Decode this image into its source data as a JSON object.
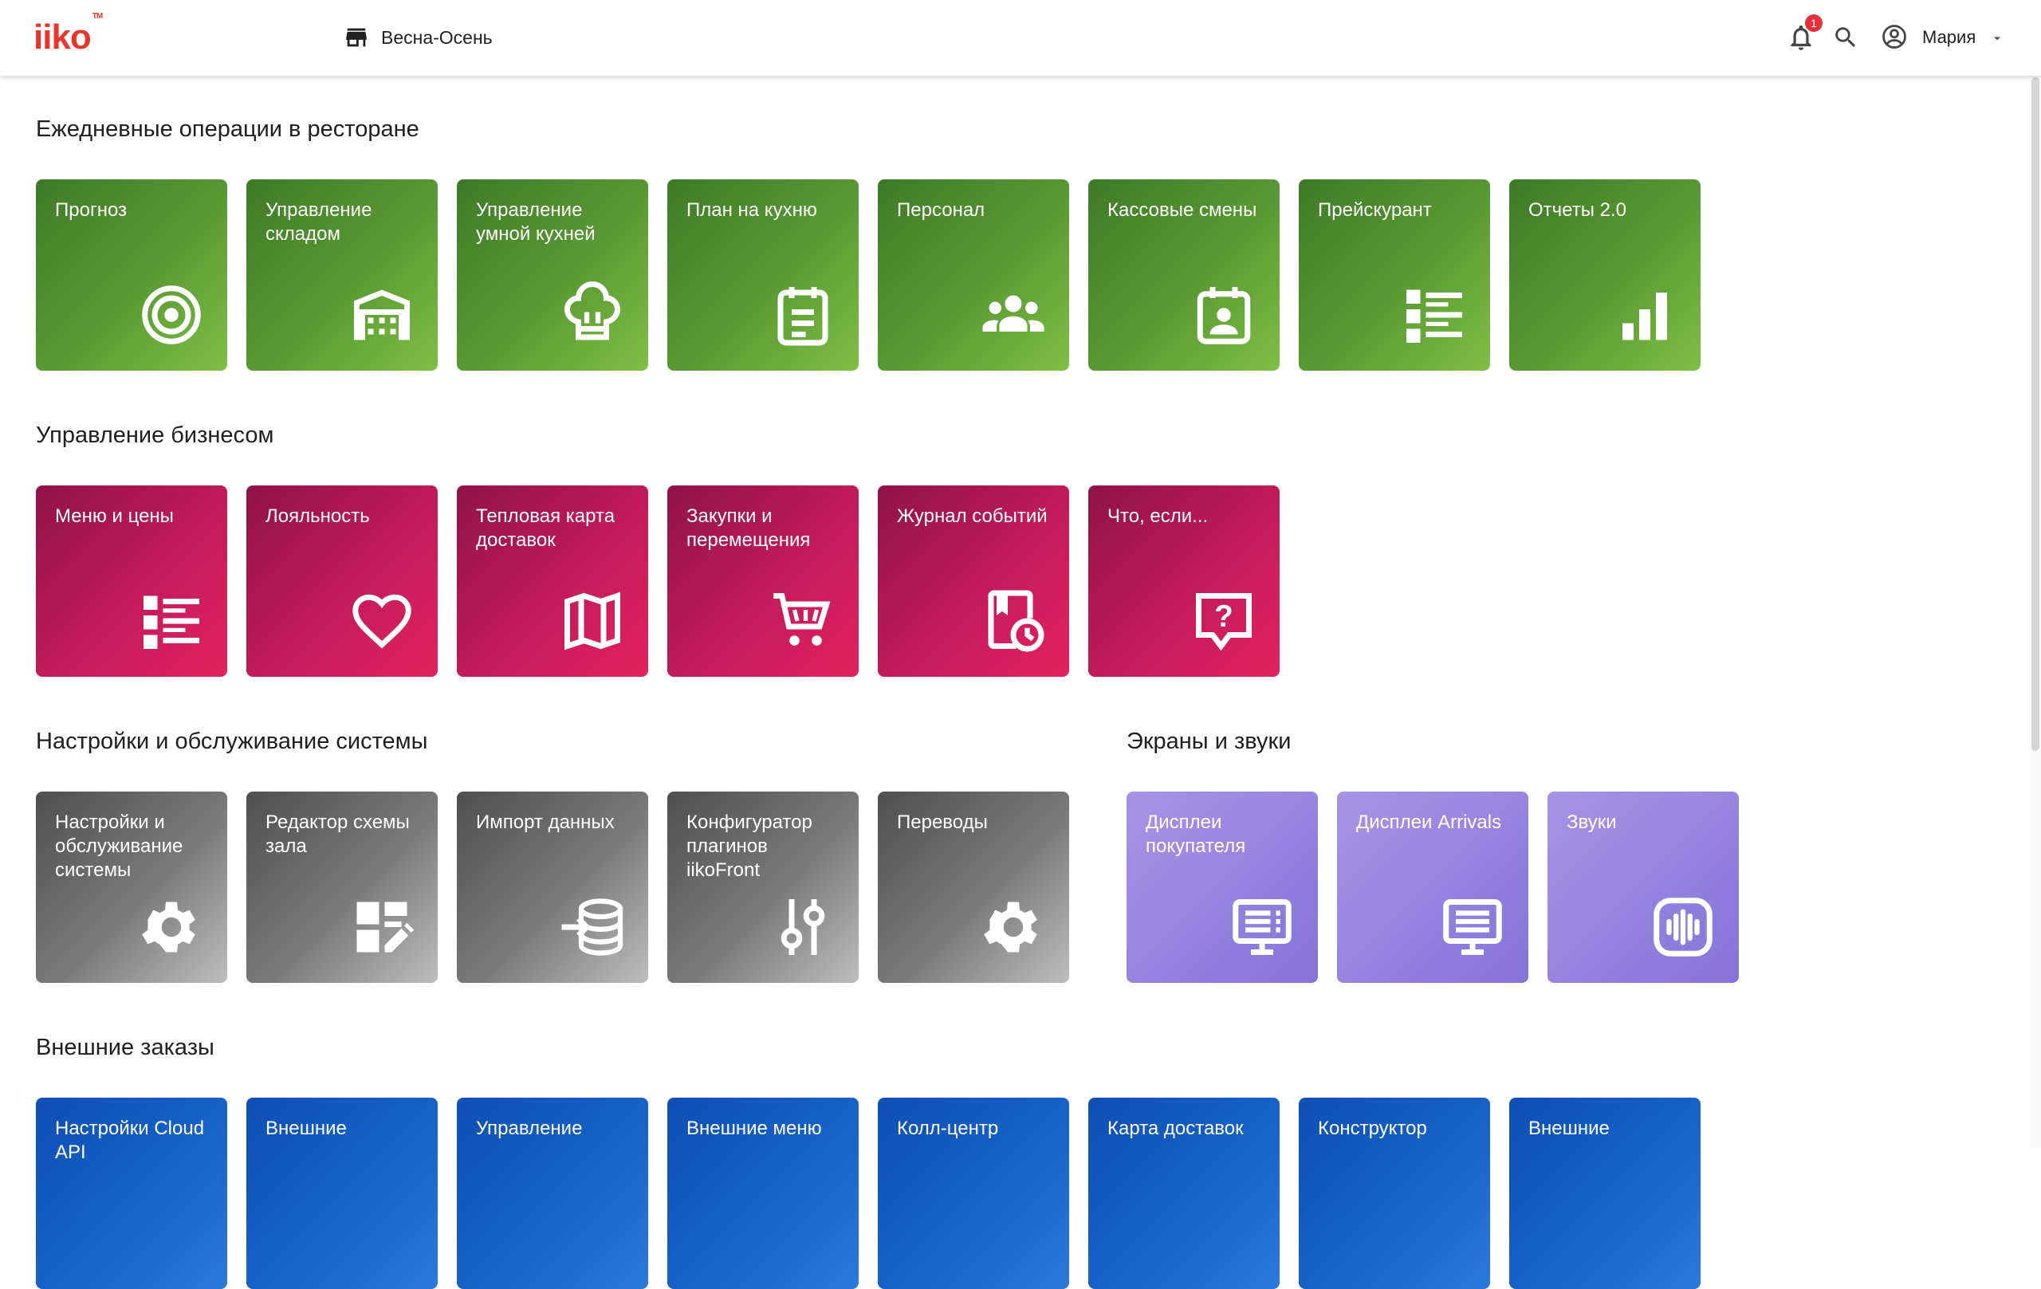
{
  "header": {
    "logo": "iiko",
    "logo_tm": "TM",
    "store_name": "Весна-Осень",
    "notifications_count": "1",
    "user_name": "Мария"
  },
  "sections": {
    "daily": {
      "title": "Ежедневные операции в ресторане",
      "tiles": [
        {
          "label": "Прогноз",
          "icon": "target-icon"
        },
        {
          "label": "Управление складом",
          "icon": "warehouse-icon"
        },
        {
          "label": "Управление умной кухней",
          "icon": "chef-hat-icon"
        },
        {
          "label": "План на кухню",
          "icon": "clipboard-icon"
        },
        {
          "label": "Персонал",
          "icon": "people-icon"
        },
        {
          "label": "Кассовые смены",
          "icon": "calendar-person-icon"
        },
        {
          "label": "Прейскурант",
          "icon": "list-icon"
        },
        {
          "label": "Отчеты 2.0",
          "icon": "bar-chart-icon"
        }
      ]
    },
    "business": {
      "title": "Управление бизнесом",
      "tiles": [
        {
          "label": "Меню и цены",
          "icon": "list-icon"
        },
        {
          "label": "Лояльность",
          "icon": "heart-icon"
        },
        {
          "label": "Тепловая карта доставок",
          "icon": "map-icon"
        },
        {
          "label": "Закупки и перемещения",
          "icon": "cart-icon"
        },
        {
          "label": "Журнал событий",
          "icon": "journal-clock-icon"
        },
        {
          "label": "Что, если...",
          "icon": "question-bubble-icon"
        }
      ]
    },
    "settings": {
      "title": "Настройки и обслуживание системы",
      "tiles": [
        {
          "label": "Настройки и обслуживание системы",
          "icon": "gear-icon"
        },
        {
          "label": "Редактор схемы зала",
          "icon": "layout-edit-icon"
        },
        {
          "label": "Импорт данных",
          "icon": "database-import-icon"
        },
        {
          "label": "Конфигуратор плагинов iikoFront",
          "icon": "sliders-icon"
        },
        {
          "label": "Переводы",
          "icon": "gear-icon"
        }
      ]
    },
    "screens": {
      "title": "Экраны и звуки",
      "tiles": [
        {
          "label": "Дисплеи покупателя",
          "icon": "monitor-icon"
        },
        {
          "label": "Дисплеи Arrivals",
          "icon": "monitor-icon"
        },
        {
          "label": "Звуки",
          "icon": "sound-wave-icon"
        }
      ]
    },
    "external": {
      "title": "Внешние заказы",
      "tiles": [
        {
          "label": "Настройки Cloud API"
        },
        {
          "label": "Внешние"
        },
        {
          "label": "Управление"
        },
        {
          "label": "Внешние меню"
        },
        {
          "label": "Колл-центр"
        },
        {
          "label": "Карта доставок"
        },
        {
          "label": "Конструктор"
        },
        {
          "label": "Внешние"
        }
      ]
    }
  }
}
